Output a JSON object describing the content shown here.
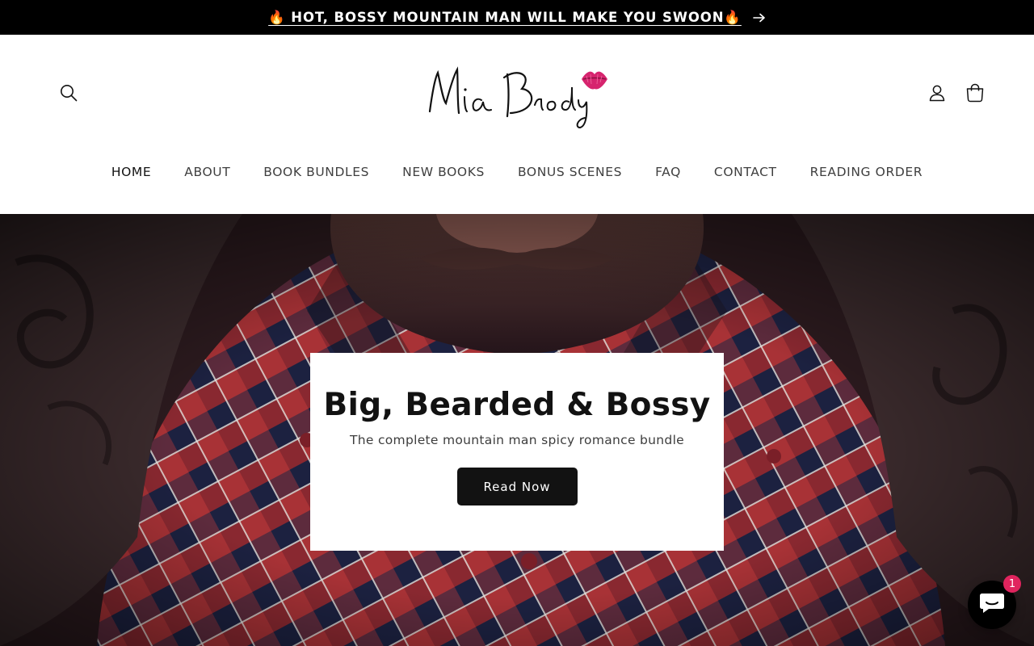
{
  "announcement": {
    "text": "🔥 HOT, BOSSY MOUNTAIN MAN WILL MAKE YOU SWOON🔥",
    "arrow_icon": "arrow-right-icon"
  },
  "header": {
    "logo_text": "Mia Brody",
    "icons": {
      "search": "search-icon",
      "account": "account-icon",
      "cart": "cart-icon"
    }
  },
  "nav": {
    "items": [
      {
        "label": "HOME",
        "active": true
      },
      {
        "label": "ABOUT"
      },
      {
        "label": "BOOK BUNDLES"
      },
      {
        "label": "NEW BOOKS"
      },
      {
        "label": "BONUS SCENES"
      },
      {
        "label": "FAQ"
      },
      {
        "label": "CONTACT"
      },
      {
        "label": "READING ORDER"
      }
    ]
  },
  "hero": {
    "heading": "Big, Bearded & Bossy",
    "subheading": "The complete mountain man spicy romance bundle",
    "button_label": "Read Now"
  },
  "chat": {
    "badge_count": "1",
    "icon": "chat-icon"
  },
  "colors": {
    "announcement_bg": "#000000",
    "button_bg": "#121212",
    "badge": "#e0245e",
    "plaid_red": "#b8373a",
    "plaid_navy": "#232846",
    "lips": "#d6246e"
  }
}
